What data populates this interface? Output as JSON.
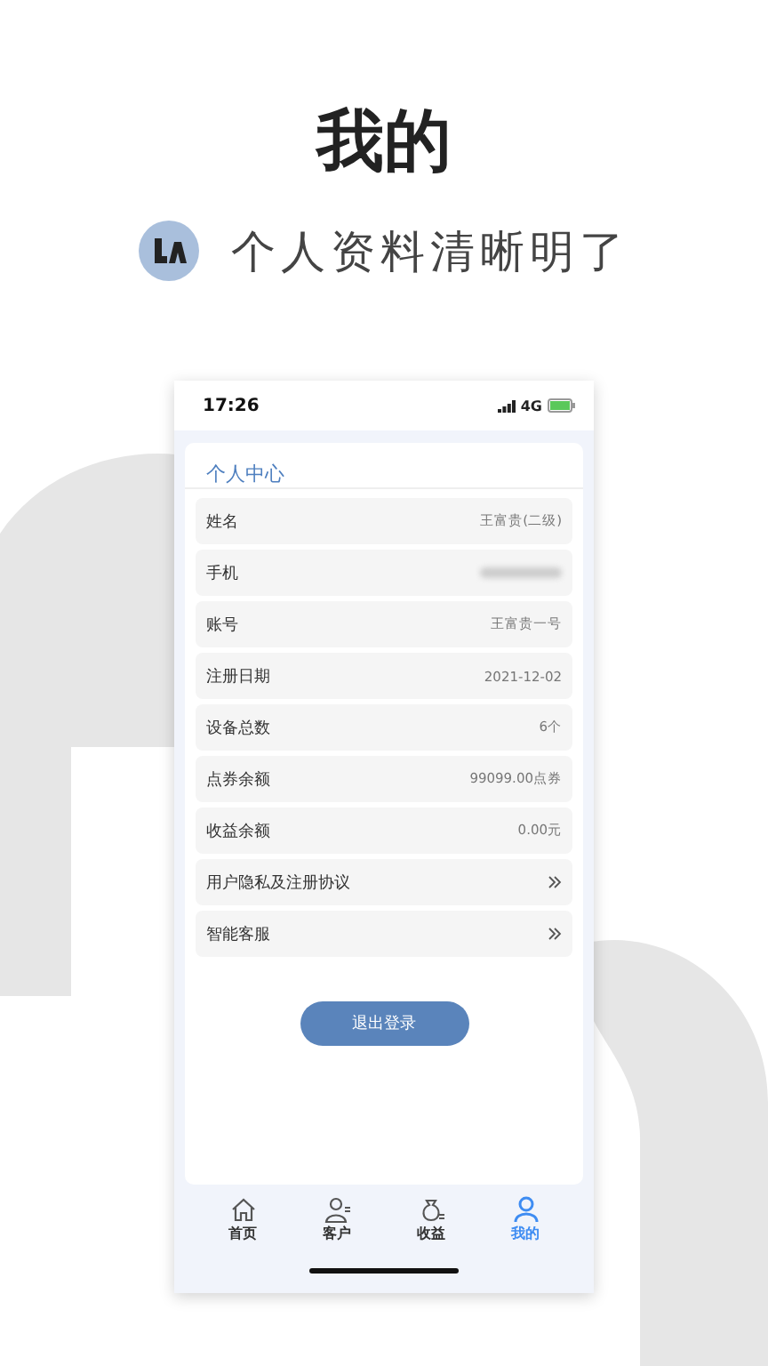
{
  "headline": "我的",
  "subtitle": "个人资料清晰明了",
  "status_bar": {
    "time": "17:26",
    "network": "4G"
  },
  "page_title": "个人中心",
  "rows": [
    {
      "kind": "info",
      "label": "姓名",
      "value": "王富贵(二级)"
    },
    {
      "kind": "info",
      "label": "手机",
      "blurred": true
    },
    {
      "kind": "info",
      "label": "账号",
      "value": "王富贵一号"
    },
    {
      "kind": "info",
      "label": "注册日期",
      "value": "2021-12-02"
    },
    {
      "kind": "info",
      "label": "设备总数",
      "value": "6个"
    },
    {
      "kind": "info",
      "label": "点券余额",
      "value": "99099.00点券"
    },
    {
      "kind": "info",
      "label": "收益余额",
      "value": "0.00元"
    },
    {
      "kind": "link",
      "label": "用户隐私及注册协议"
    },
    {
      "kind": "link",
      "label": "智能客服"
    }
  ],
  "logout_button": "退出登录",
  "tabs": [
    {
      "kind": "home",
      "label": "首页",
      "selected": false
    },
    {
      "kind": "client",
      "label": "客户",
      "selected": false
    },
    {
      "kind": "income",
      "label": "收益",
      "selected": false
    },
    {
      "kind": "me",
      "label": "我的",
      "selected": true
    }
  ]
}
